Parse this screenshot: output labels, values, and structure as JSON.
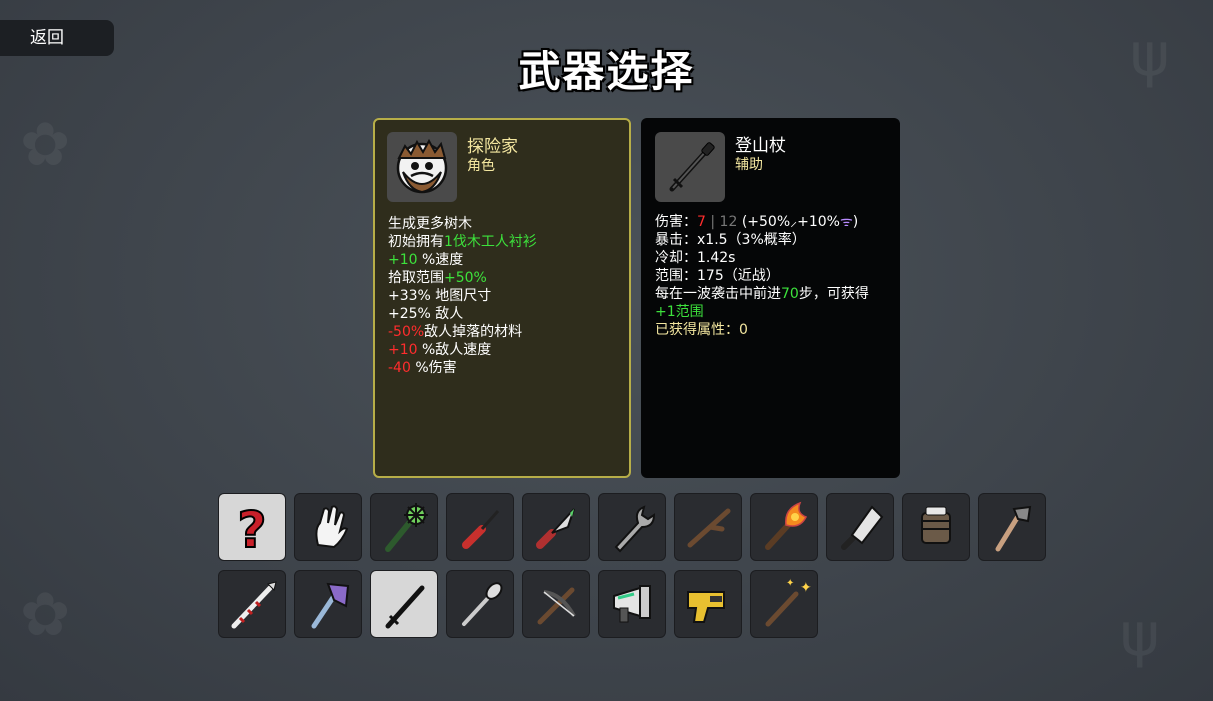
{
  "back_label": "返回",
  "title": "武器选择",
  "character": {
    "name": "探险家",
    "type": "角色",
    "lines": [
      {
        "parts": [
          {
            "t": "生成更多树木",
            "c": ""
          }
        ]
      },
      {
        "parts": [
          {
            "t": "初始拥有",
            "c": ""
          },
          {
            "t": "1伐木工人衬衫",
            "c": "green"
          }
        ]
      },
      {
        "parts": [
          {
            "t": "+10",
            "c": "green"
          },
          {
            "t": " %速度",
            "c": ""
          }
        ]
      },
      {
        "parts": [
          {
            "t": "拾取范围",
            "c": ""
          },
          {
            "t": "+50%",
            "c": "green"
          }
        ]
      },
      {
        "parts": [
          {
            "t": "+33% 地图尺寸",
            "c": ""
          }
        ]
      },
      {
        "parts": [
          {
            "t": "+25% 敌人",
            "c": ""
          }
        ]
      },
      {
        "parts": [
          {
            "t": "-50%",
            "c": "red"
          },
          {
            "t": "敌人掉落的材料",
            "c": ""
          }
        ]
      },
      {
        "parts": [
          {
            "t": "+10",
            "c": "red"
          },
          {
            "t": " %敌人速度",
            "c": ""
          }
        ]
      },
      {
        "parts": [
          {
            "t": "-40",
            "c": "red"
          },
          {
            "t": " %伤害",
            "c": ""
          }
        ]
      }
    ]
  },
  "weapon": {
    "name": "登山杖",
    "type": "辅助",
    "lines": [
      {
        "parts": [
          {
            "t": "伤害：",
            "c": ""
          },
          {
            "t": "7",
            "c": "red"
          },
          {
            "t": " | ",
            "c": "grey"
          },
          {
            "t": "12",
            "c": "grey"
          },
          {
            "t": " (+50%",
            "c": ""
          },
          {
            "t": "⸝",
            "c": ""
          },
          {
            "t": "+10%",
            "c": ""
          },
          {
            "t": "ᯤ",
            "c": "purple"
          },
          {
            "t": ")",
            "c": ""
          }
        ]
      },
      {
        "parts": [
          {
            "t": "暴击：x1.5（3%概率）",
            "c": ""
          }
        ]
      },
      {
        "parts": [
          {
            "t": "冷却：1.42s",
            "c": ""
          }
        ]
      },
      {
        "parts": [
          {
            "t": "范围：175（近战）",
            "c": ""
          }
        ]
      },
      {
        "parts": [
          {
            "t": "每在一波袭击中前进",
            "c": ""
          },
          {
            "t": "70",
            "c": "green"
          },
          {
            "t": "步，可获得",
            "c": ""
          }
        ]
      },
      {
        "parts": [
          {
            "t": "+1范围",
            "c": "green"
          }
        ]
      },
      {
        "parts": [
          {
            "t": "已获得属性：0",
            "c": "yellow"
          }
        ]
      }
    ]
  },
  "weapon_slots": [
    {
      "icon": "random-question-icon",
      "selected": false,
      "light": true
    },
    {
      "icon": "hand-icon",
      "selected": false,
      "light": false
    },
    {
      "icon": "spiked-club-icon",
      "selected": false,
      "light": false
    },
    {
      "icon": "screwdriver-icon",
      "selected": false,
      "light": false
    },
    {
      "icon": "knife-icon",
      "selected": false,
      "light": false
    },
    {
      "icon": "wrench-icon",
      "selected": false,
      "light": false
    },
    {
      "icon": "stick-icon",
      "selected": false,
      "light": false
    },
    {
      "icon": "torch-icon",
      "selected": false,
      "light": false
    },
    {
      "icon": "cleaver-icon",
      "selected": false,
      "light": false
    },
    {
      "icon": "fist-gauntlet-icon",
      "selected": false,
      "light": false
    },
    {
      "icon": "hatchet-icon",
      "selected": false,
      "light": false
    },
    {
      "icon": "spear-icon",
      "selected": false,
      "light": false
    },
    {
      "icon": "crystal-axe-icon",
      "selected": false,
      "light": false
    },
    {
      "icon": "hiking-pole-icon",
      "selected": true,
      "light": true
    },
    {
      "icon": "spoon-icon",
      "selected": false,
      "light": false
    },
    {
      "icon": "crossbow-icon",
      "selected": false,
      "light": false
    },
    {
      "icon": "megaphone-gun-icon",
      "selected": false,
      "light": false
    },
    {
      "icon": "taser-icon",
      "selected": false,
      "light": false
    },
    {
      "icon": "magic-wand-icon",
      "selected": false,
      "light": false
    }
  ]
}
